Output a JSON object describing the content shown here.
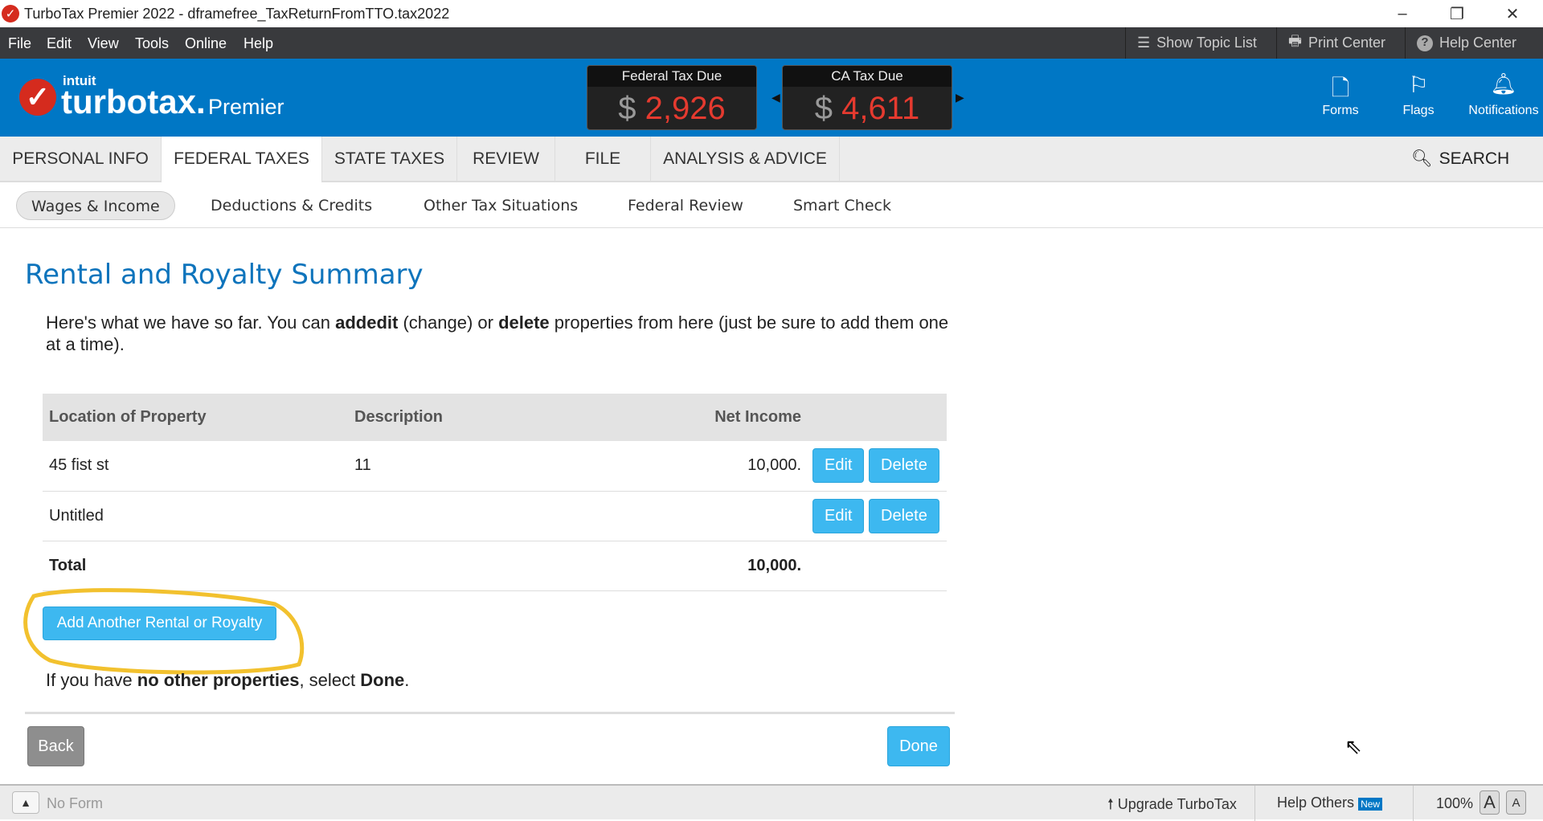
{
  "window": {
    "title": "TurboTax Premier 2022 - dframefree_TaxReturnFromTTO.tax2022",
    "minimize": "–",
    "restore": "❐",
    "close": "✕"
  },
  "menu": {
    "items": [
      "File",
      "Edit",
      "View",
      "Tools",
      "Online",
      "Help"
    ],
    "tools": {
      "topic_list": "Show Topic List",
      "print_center": "Print Center",
      "help_center": "Help Center"
    }
  },
  "header": {
    "brand_intuit": "intuit",
    "brand_name": "turbotax.",
    "brand_edition": "Premier",
    "federal": {
      "label": "Federal Tax Due",
      "currency": "$",
      "amount": "2,926"
    },
    "state": {
      "label": "CA Tax Due",
      "currency": "$",
      "amount": "4,611"
    },
    "icons": {
      "forms": "Forms",
      "flags": "Flags",
      "notifications": "Notifications"
    }
  },
  "nav": {
    "tabs": [
      "PERSONAL INFO",
      "FEDERAL TAXES",
      "STATE TAXES",
      "REVIEW",
      "FILE",
      "ANALYSIS & ADVICE"
    ],
    "search": "SEARCH"
  },
  "subnav": {
    "tabs": [
      "Wages & Income",
      "Deductions & Credits",
      "Other Tax Situations",
      "Federal Review",
      "Smart Check"
    ]
  },
  "page": {
    "title": "Rental and Royalty Summary",
    "intro": {
      "p1": "Here's what we have so far. You can ",
      "b1": "add",
      ", ": ", ",
      "b2": "edit",
      "p2": " (change) or ",
      "b3": "delete",
      "p3": " properties from here (just be sure to add them one at a time)."
    },
    "table": {
      "headers": [
        "Location of Property",
        "Description",
        "Net Income"
      ],
      "rows": [
        {
          "location": "45 fist st",
          "description": "11",
          "net": "10,000."
        },
        {
          "location": "Untitled",
          "description": "",
          "net": ""
        }
      ],
      "total_label": "Total",
      "total_value": "10,000.",
      "edit": "Edit",
      "delete": "Delete"
    },
    "add_button": "Add Another Rental or Royalty",
    "footer": {
      "p1": "If you have ",
      "b1": "no other properties",
      "p2": ", select ",
      "b2": "Done",
      "p3": "."
    },
    "back": "Back",
    "done": "Done"
  },
  "status": {
    "no_form": "No Form",
    "upgrade": "Upgrade TurboTax",
    "help_others": "Help Others",
    "new_badge": "New",
    "zoom": "100%",
    "font_large": "A",
    "font_small": "A"
  },
  "colors": {
    "brand_blue": "#0077c5",
    "button_blue": "#3db8f0",
    "tax_red": "#e53a2f",
    "highlight": "#f2c12e"
  }
}
